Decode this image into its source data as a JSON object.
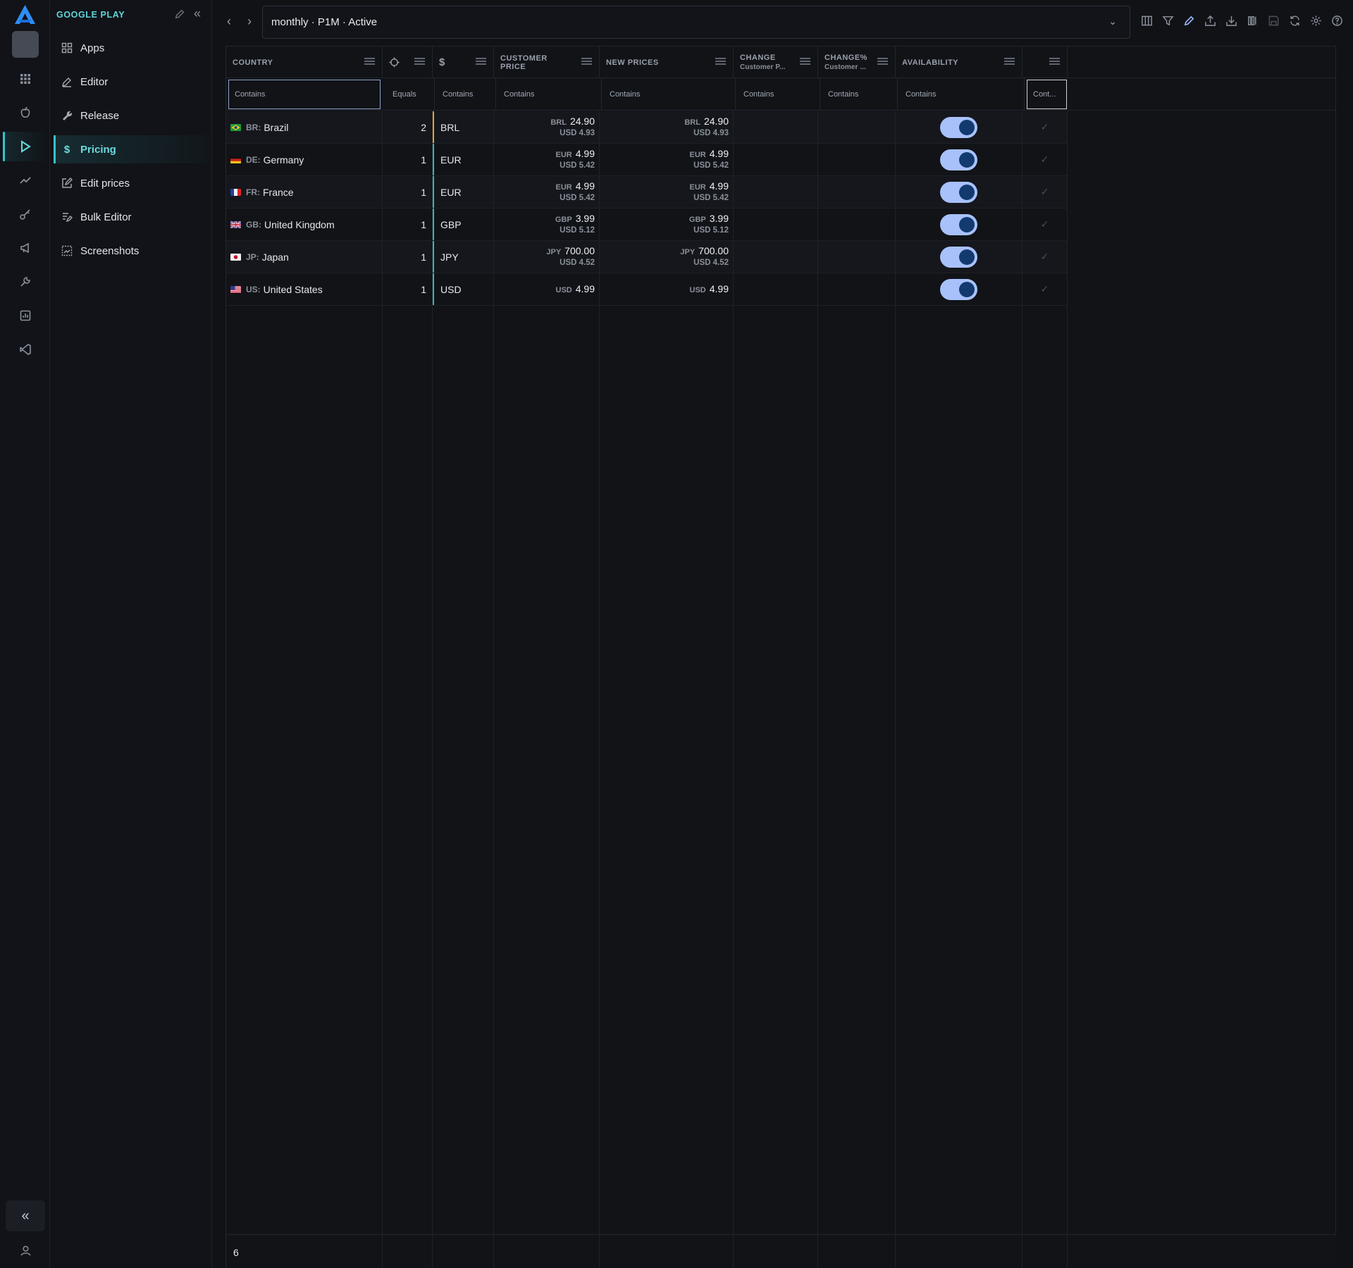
{
  "rail": {
    "items": [
      {
        "icon": "apps-grid-icon"
      },
      {
        "icon": "apple-icon"
      },
      {
        "icon": "google-play-icon",
        "active": true
      },
      {
        "icon": "analytics-icon"
      },
      {
        "icon": "keys-icon"
      },
      {
        "icon": "megaphone-icon"
      },
      {
        "icon": "tools-icon"
      },
      {
        "icon": "report-icon"
      },
      {
        "icon": "vscode-icon"
      }
    ]
  },
  "sidenav": {
    "section": "GOOGLE PLAY",
    "items": [
      {
        "label": "Apps",
        "icon": "grid-icon"
      },
      {
        "label": "Editor",
        "icon": "edit-icon"
      },
      {
        "label": "Release",
        "icon": "wrench-icon"
      },
      {
        "label": "Pricing",
        "icon": "dollar-icon",
        "active": true
      },
      {
        "label": "Edit prices",
        "icon": "edit-square-icon"
      },
      {
        "label": "Bulk Editor",
        "icon": "bulk-edit-icon"
      },
      {
        "label": "Screenshots",
        "icon": "screenshot-icon"
      }
    ]
  },
  "topbar": {
    "selector": "monthly · P1M · Active"
  },
  "grid": {
    "headers": {
      "country": "COUNTRY",
      "target": "",
      "currency": "$",
      "customer_price": "CUSTOMER PRICE",
      "new_prices": "NEW PRICES",
      "change": "CHANGE",
      "change_sub": "Customer P...",
      "change_pct": "CHANGE%",
      "change_pct_sub": "Customer ...",
      "availability": "AVAILABILITY",
      "last": ""
    },
    "filters": {
      "country": "Contains",
      "target": "Equals",
      "currency": "Contains",
      "customer_price": "Contains",
      "new_prices": "Contains",
      "change": "Contains",
      "change_pct": "Contains",
      "availability": "Contains",
      "last": "Cont..."
    },
    "rows": [
      {
        "code": "BR:",
        "country": "Brazil",
        "n": "2",
        "currency": "BRL",
        "cp_cc": "BRL",
        "cp": "24.90",
        "cp_usd": "USD 4.93",
        "np_cc": "BRL",
        "np": "24.90",
        "np_usd": "USD 4.93",
        "available": true
      },
      {
        "code": "DE:",
        "country": "Germany",
        "n": "1",
        "currency": "EUR",
        "cp_cc": "EUR",
        "cp": "4.99",
        "cp_usd": "USD 5.42",
        "np_cc": "EUR",
        "np": "4.99",
        "np_usd": "USD 5.42",
        "available": true
      },
      {
        "code": "FR:",
        "country": "France",
        "n": "1",
        "currency": "EUR",
        "cp_cc": "EUR",
        "cp": "4.99",
        "cp_usd": "USD 5.42",
        "np_cc": "EUR",
        "np": "4.99",
        "np_usd": "USD 5.42",
        "available": true
      },
      {
        "code": "GB:",
        "country": "United Kingdom",
        "n": "1",
        "currency": "GBP",
        "cp_cc": "GBP",
        "cp": "3.99",
        "cp_usd": "USD 5.12",
        "np_cc": "GBP",
        "np": "3.99",
        "np_usd": "USD 5.12",
        "available": true
      },
      {
        "code": "JP:",
        "country": "Japan",
        "n": "1",
        "currency": "JPY",
        "cp_cc": "JPY",
        "cp": "700.00",
        "cp_usd": "USD 4.52",
        "np_cc": "JPY",
        "np": "700.00",
        "np_usd": "USD 4.52",
        "available": true
      },
      {
        "code": "US:",
        "country": "United States",
        "n": "1",
        "currency": "USD",
        "cp_cc": "USD",
        "cp": "4.99",
        "cp_usd": "",
        "np_cc": "USD",
        "np": "4.99",
        "np_usd": "",
        "available": true
      }
    ],
    "footer_count": "6"
  },
  "colors": {
    "accent": "#35c4c9",
    "toggle_on": "#a8c1fb",
    "toggle_knob": "#133a6e",
    "brl_marker": "#e5a332",
    "currency_marker": "#3bb7b4"
  }
}
